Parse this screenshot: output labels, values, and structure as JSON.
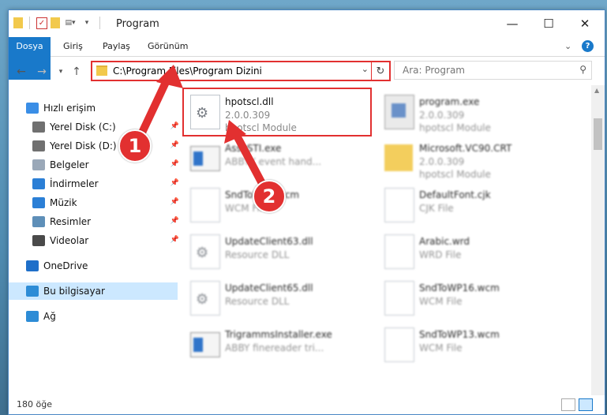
{
  "window": {
    "title": "Program",
    "minimize_glyph": "—",
    "maximize_glyph": "☐",
    "close_glyph": "✕"
  },
  "ribbon": {
    "tabs": [
      "Dosya",
      "Giriş",
      "Paylaş",
      "Görünüm"
    ],
    "expand_glyph": "⌄",
    "help_glyph": "?"
  },
  "navigation": {
    "address": "C:\\Program Files\\Program Dizini",
    "search_placeholder": "Ara: Program"
  },
  "sidebar": {
    "items": [
      {
        "label": "Hızlı erişim",
        "icon": "star-icon",
        "color": "#3a8ee6"
      },
      {
        "label": "Yerel Disk (C:)",
        "icon": "drive-icon",
        "color": "#707070",
        "pinned": true
      },
      {
        "label": "Yerel Disk (D:)",
        "icon": "drive-icon",
        "color": "#707070",
        "pinned": true
      },
      {
        "label": "Belgeler",
        "icon": "documents-icon",
        "color": "#9aa8b8",
        "pinned": true
      },
      {
        "label": "İndirmeler",
        "icon": "download-icon",
        "color": "#2b7fd6",
        "pinned": true
      },
      {
        "label": "Müzik",
        "icon": "music-icon",
        "color": "#2b7fd6",
        "pinned": true
      },
      {
        "label": "Resimler",
        "icon": "pictures-icon",
        "color": "#5e8fb8",
        "pinned": true
      },
      {
        "label": "Videolar",
        "icon": "videos-icon",
        "color": "#4a4a4a",
        "pinned": true
      },
      {
        "label": "OneDrive",
        "icon": "cloud-icon",
        "color": "#1f6fc9"
      },
      {
        "label": "Bu bilgisayar",
        "icon": "computer-icon",
        "color": "#2d8cd6",
        "selected": true
      },
      {
        "label": "Ağ",
        "icon": "network-icon",
        "color": "#2d8cd6"
      }
    ]
  },
  "files": [
    {
      "name": "hpotscl.dll",
      "line2": "2.0.0.309",
      "line3": "hpotscl Module",
      "icon": "dll-gear-icon",
      "highlighted": true
    },
    {
      "name": "program.exe",
      "line2": "2.0.0.309",
      "line3": "hpotscl Module",
      "icon": "exe-icon",
      "blurred": true
    },
    {
      "name": "AssySTI.exe",
      "line2": "ABBYY event hand...",
      "line3": "",
      "icon": "app-window-icon",
      "blurred": true
    },
    {
      "name": "Microsoft.VC90.CRT",
      "line2": "2.0.0.309",
      "line3": "hpotscl Module",
      "icon": "folder-icon",
      "blurred": true
    },
    {
      "name": "SndToWP1.wcm",
      "line2": "WCM File",
      "line3": "",
      "icon": "document-icon",
      "blurred": true
    },
    {
      "name": "DefaultFont.cjk",
      "line2": "CJK File",
      "line3": "",
      "icon": "document-icon",
      "blurred": true
    },
    {
      "name": "UpdateClient63.dll",
      "line2": "Resource DLL",
      "line3": "",
      "icon": "dll-gear-icon",
      "blurred": true
    },
    {
      "name": "Arabic.wrd",
      "line2": "WRD File",
      "line3": "",
      "icon": "document-icon",
      "blurred": true
    },
    {
      "name": "UpdateClient65.dll",
      "line2": "Resource DLL",
      "line3": "",
      "icon": "dll-gear-icon",
      "blurred": true
    },
    {
      "name": "SndToWP16.wcm",
      "line2": "WCM File",
      "line3": "",
      "icon": "document-icon",
      "blurred": true
    },
    {
      "name": "TrigrammsInstaller.exe",
      "line2": "ABBY finereader tri...",
      "line3": "",
      "icon": "app-window-icon",
      "blurred": true
    },
    {
      "name": "SndToWP13.wcm",
      "line2": "WCM File",
      "line3": "",
      "icon": "document-icon",
      "blurred": true
    }
  ],
  "status": {
    "item_count": "180 öğe"
  },
  "annotations": {
    "callout_1": "1",
    "callout_2": "2",
    "accent_color": "#e23030"
  }
}
